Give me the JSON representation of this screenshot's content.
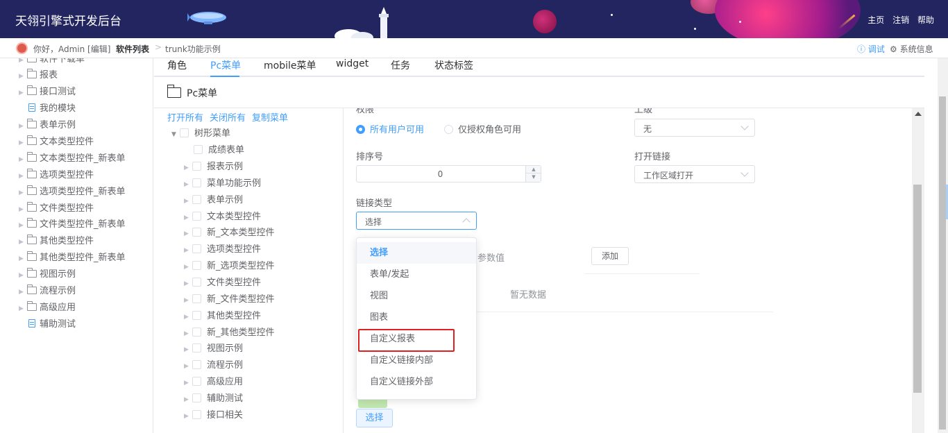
{
  "header": {
    "title": "天翎引擎式开发后台",
    "nav": [
      "主页",
      "注销",
      "帮助"
    ]
  },
  "breadcrumb": {
    "greeting": "你好，Admin [编辑]",
    "crumb1": "软件列表",
    "sep": ">",
    "crumb2": "trunk功能示例",
    "debug": "ⓘ 调试",
    "sysinfo": "⚙ 系统信息"
  },
  "sidebar": {
    "items": [
      {
        "label": "软件下载单",
        "type": "folder"
      },
      {
        "label": "报表",
        "type": "folder"
      },
      {
        "label": "接口测试",
        "type": "folder"
      },
      {
        "label": "我的模块",
        "type": "doc"
      },
      {
        "label": "表单示例",
        "type": "folder"
      },
      {
        "label": "文本类型控件",
        "type": "folder"
      },
      {
        "label": "文本类型控件_新表单",
        "type": "folder"
      },
      {
        "label": "选项类型控件",
        "type": "folder"
      },
      {
        "label": "选项类型控件_新表单",
        "type": "folder"
      },
      {
        "label": "文件类型控件",
        "type": "folder"
      },
      {
        "label": "文件类型控件_新表单",
        "type": "folder"
      },
      {
        "label": "其他类型控件",
        "type": "folder"
      },
      {
        "label": "其他类型控件_新表单",
        "type": "folder"
      },
      {
        "label": "视图示例",
        "type": "folder"
      },
      {
        "label": "流程示例",
        "type": "folder"
      },
      {
        "label": "高级应用",
        "type": "folder"
      },
      {
        "label": "辅助测试",
        "type": "doc"
      }
    ]
  },
  "tabs": [
    "角色",
    "Pc菜单",
    "mobile菜单",
    "widget",
    "任务",
    "状态标签"
  ],
  "section_title": "Pc菜单",
  "tree": {
    "actions": [
      "打开所有",
      "关闭所有",
      "复制菜单"
    ],
    "root": "树形菜单",
    "children": [
      "成绩表单",
      "报表示例",
      "菜单功能示例",
      "表单示例",
      "文本类型控件",
      "新_文本类型控件",
      "选项类型控件",
      "新_选项类型控件",
      "文件类型控件",
      "新_文件类型控件",
      "其他类型控件",
      "新_其他类型控件",
      "视图示例",
      "流程示例",
      "高级应用",
      "辅助测试",
      "接口相关"
    ]
  },
  "form": {
    "permission_label": "权限",
    "radio_all": "所有用户可用",
    "radio_authorized": "仅授权角色可用",
    "parent_label": "上级",
    "parent_value": "无",
    "order_label": "排序号",
    "order_value": "0",
    "open_link_label": "打开链接",
    "open_link_value": "工作区域打开",
    "link_type_label": "链接类型",
    "link_type_value": "选择",
    "param_value_label": "参数值",
    "add_button": "添加",
    "empty_text": "暂无数据",
    "choose_button": "选择"
  },
  "dropdown": {
    "options": [
      "选择",
      "表单/发起",
      "视图",
      "图表",
      "自定义报表",
      "自定义链接内部",
      "自定义链接外部"
    ],
    "selected": "选择",
    "highlighted": "自定义报表"
  },
  "colors": {
    "header_bg": "#222560",
    "accent": "#409eff",
    "highlight_border": "#e02020"
  }
}
